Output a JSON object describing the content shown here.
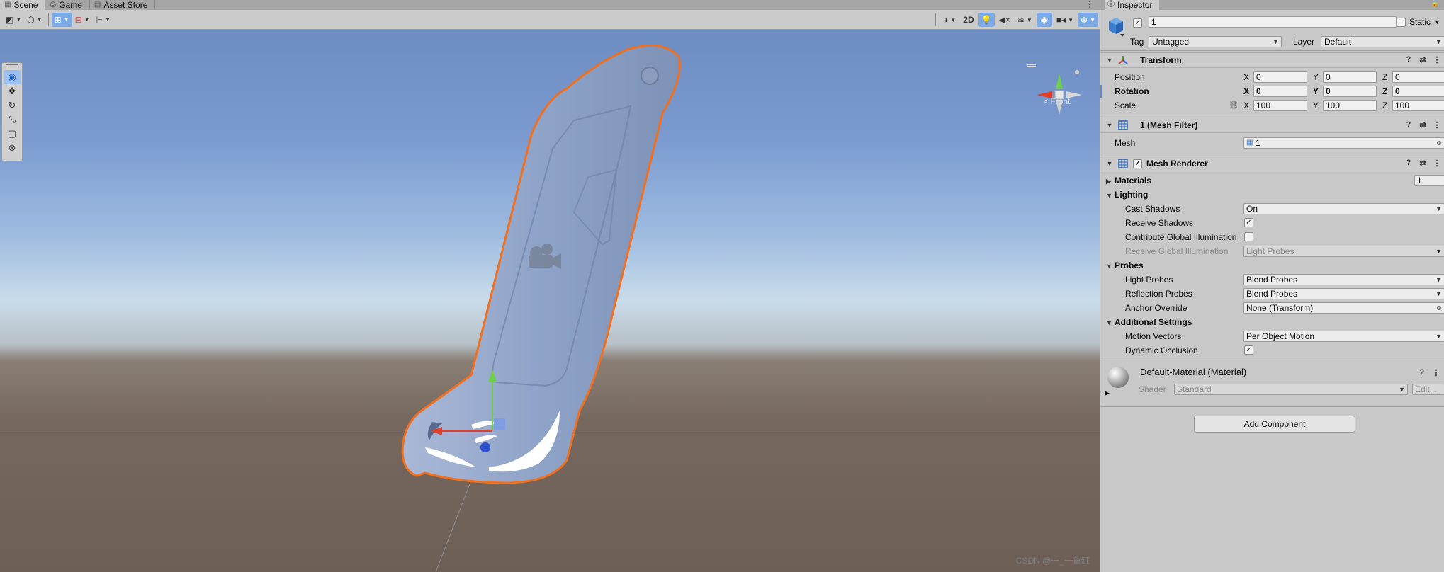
{
  "scene_tabs": [
    {
      "icon": "grid-icon",
      "label": "Scene"
    },
    {
      "icon": "gamepad-icon",
      "label": "Game"
    },
    {
      "icon": "store-icon",
      "label": "Asset Store"
    }
  ],
  "scene_toolbar": {
    "toggle_2d_label": "2D"
  },
  "viewport": {
    "orientation_label": "< Front",
    "watermark": "CSDN @一_一鱼缸"
  },
  "inspector": {
    "tab_label": "Inspector",
    "object_name": "1",
    "static_label": "Static",
    "tag_label": "Tag",
    "tag_value": "Untagged",
    "layer_label": "Layer",
    "layer_value": "Default",
    "transform": {
      "title": "Transform",
      "position": {
        "label": "Position",
        "x": "0",
        "y": "0",
        "z": "0"
      },
      "rotation": {
        "label": "Rotation",
        "x": "0",
        "y": "0",
        "z": "0"
      },
      "scale": {
        "label": "Scale",
        "x": "100",
        "y": "100",
        "z": "100"
      }
    },
    "mesh_filter": {
      "title": "1 (Mesh Filter)",
      "mesh_label": "Mesh",
      "mesh_value": "1"
    },
    "mesh_renderer": {
      "title": "Mesh Renderer",
      "materials_label": "Materials",
      "materials_count": "1",
      "lighting_label": "Lighting",
      "cast_shadows_label": "Cast Shadows",
      "cast_shadows_value": "On",
      "receive_shadows_label": "Receive Shadows",
      "contribute_gi_label": "Contribute Global Illumination",
      "receive_gi_label": "Receive Global Illumination",
      "receive_gi_value": "Light Probes",
      "probes_label": "Probes",
      "light_probes_label": "Light Probes",
      "light_probes_value": "Blend Probes",
      "reflection_probes_label": "Reflection Probes",
      "reflection_probes_value": "Blend Probes",
      "anchor_override_label": "Anchor Override",
      "anchor_override_value": "None (Transform)",
      "additional_label": "Additional Settings",
      "motion_vectors_label": "Motion Vectors",
      "motion_vectors_value": "Per Object Motion",
      "dynamic_occlusion_label": "Dynamic Occlusion"
    },
    "material": {
      "title": "Default-Material (Material)",
      "shader_label": "Shader",
      "shader_value": "Standard",
      "edit_label": "Edit..."
    },
    "add_component_label": "Add Component"
  }
}
